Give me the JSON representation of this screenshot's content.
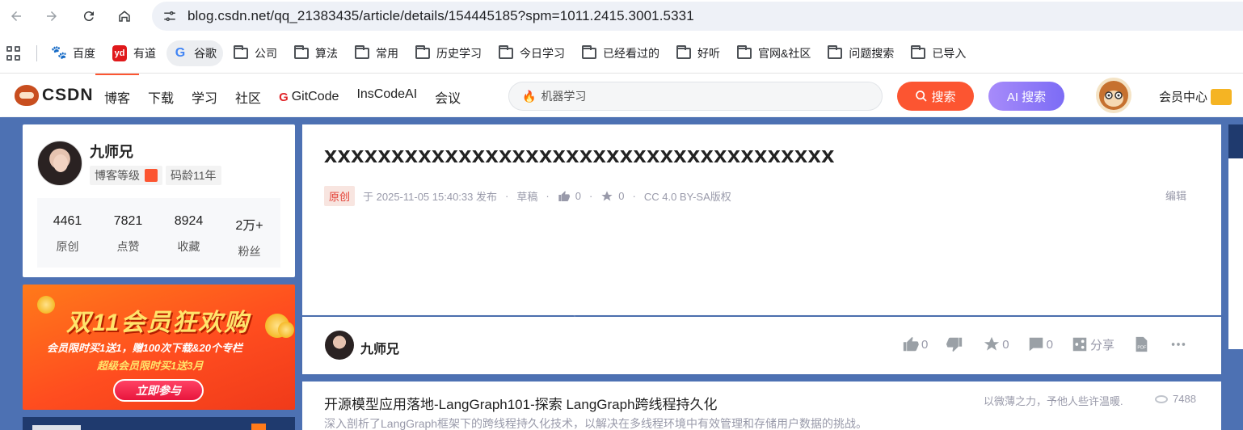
{
  "browser": {
    "url": "blog.csdn.net/qq_21383435/article/details/154445185?spm=1011.2415.3001.5331",
    "bookmarks": [
      {
        "label": "百度",
        "icon": "baidu-icon"
      },
      {
        "label": "有道",
        "icon": "youdao-icon"
      },
      {
        "label": "谷歌",
        "icon": "google-icon"
      },
      {
        "label": "公司",
        "icon": "folder-icon"
      },
      {
        "label": "算法",
        "icon": "folder-icon"
      },
      {
        "label": "常用",
        "icon": "folder-icon"
      },
      {
        "label": "历史学习",
        "icon": "folder-icon"
      },
      {
        "label": "今日学习",
        "icon": "folder-icon"
      },
      {
        "label": "已经看过的",
        "icon": "folder-icon"
      },
      {
        "label": "好听",
        "icon": "folder-icon"
      },
      {
        "label": "官网&社区",
        "icon": "folder-icon"
      },
      {
        "label": "问题搜索",
        "icon": "folder-icon"
      },
      {
        "label": "已导入",
        "icon": "folder-icon"
      }
    ]
  },
  "toolbar": {
    "logo": "CSDN",
    "nav": [
      "博客",
      "下载",
      "学习",
      "社区",
      "GitCode",
      "InsCodeAI",
      "会议"
    ],
    "search_placeholder": "机器学习",
    "search_button": "搜索",
    "ai_search_button": "AI 搜索",
    "vip_label": "会员中心",
    "accent": "#fc5531"
  },
  "profile": {
    "name": "九师兄",
    "level_badge": "博客等级",
    "age_badge": "码龄11年",
    "stats": [
      {
        "value": "4461",
        "label": "原创"
      },
      {
        "value": "7821",
        "label": "点赞"
      },
      {
        "value": "8924",
        "label": "收藏"
      },
      {
        "value": "2万+",
        "label": "粉丝"
      }
    ]
  },
  "promo": {
    "title": "双11会员狂欢购",
    "line1": "会员限时买1送1，赠100次下载&20个专栏",
    "line2": "超级会员限时买1送3月",
    "button": "立即参与"
  },
  "article": {
    "title": "xxxxxxxxxxxxxxxxxxxxxxxxxxxxxxxxxxxxxx",
    "tag": "原创",
    "published": "于 2025-11-05 15:40:33 发布",
    "draft": "草稿",
    "likes": "0",
    "favorites": "0",
    "license": "CC 4.0 BY-SA版权",
    "edit": "编辑"
  },
  "action_bar": {
    "author": "九师兄",
    "like_count": "0",
    "favorite_count": "0",
    "comment_count": "0",
    "share_label": "分享"
  },
  "recommend": {
    "title": "开源模型应用落地-LangGraph101-探索 LangGraph跨线程持久化",
    "desc": "深入剖析了LangGraph框架下的跨线程持久化技术，以解决在多线程环境中有效管理和存储用户数据的挑战。",
    "author": "以微薄之力，予他人些许温暖.",
    "views": "7488"
  }
}
